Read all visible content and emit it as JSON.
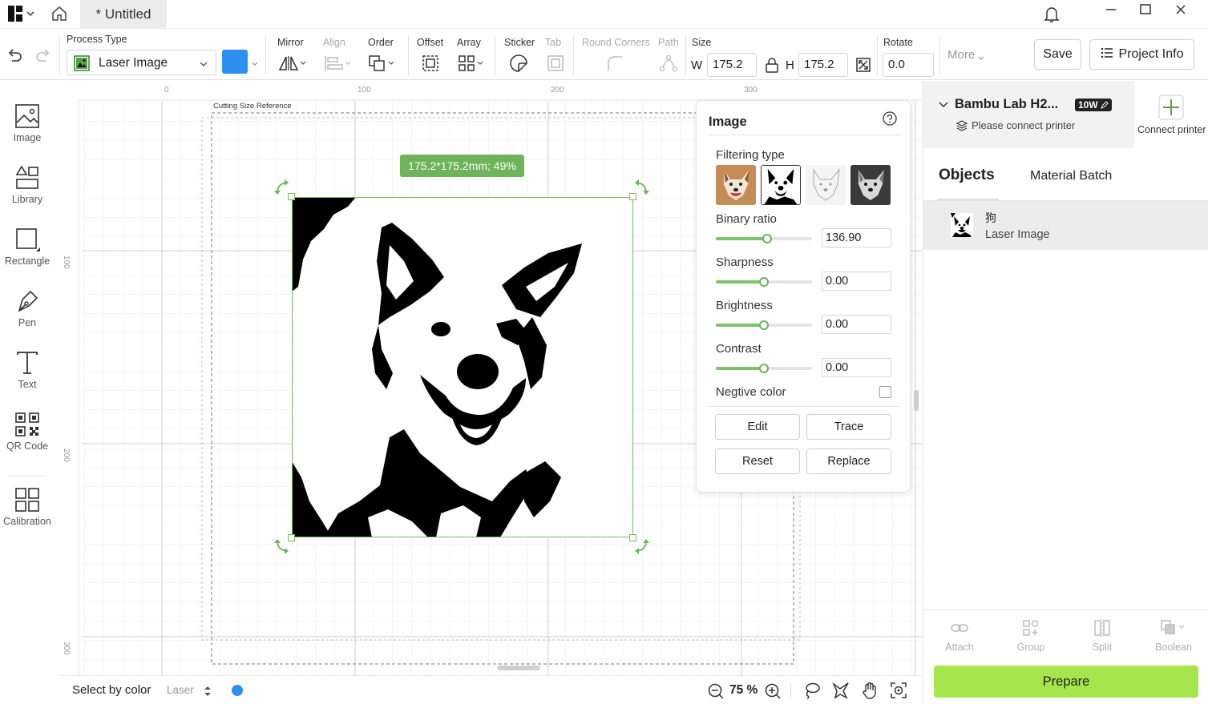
{
  "app": {
    "tab_title": "* Untitled"
  },
  "toolbar": {
    "process_type_label": "Process Type",
    "process_type_value": "Laser Image",
    "color_hex": "#2d8ff0",
    "mirror_label": "Mirror",
    "align_label": "Align",
    "order_label": "Order",
    "offset_label": "Offset",
    "array_label": "Array",
    "sticker_label": "Sticker",
    "tab_label": "Tab",
    "round_corners_label": "Round Corners",
    "path_label": "Path",
    "size_label": "Size",
    "w_label": "W",
    "w_value": "175.2",
    "h_label": "H",
    "h_value": "175.2",
    "rotate_label": "Rotate",
    "rotate_value": "0.0",
    "more_label": "More",
    "save_label": "Save",
    "project_info_label": "Project Info"
  },
  "left_tools": [
    {
      "label": "Image",
      "icon": "image-icon"
    },
    {
      "label": "Library",
      "icon": "library-icon"
    },
    {
      "label": "Rectangle",
      "icon": "rectangle-icon"
    },
    {
      "label": "Pen",
      "icon": "pen-icon"
    },
    {
      "label": "Text",
      "icon": "text-icon"
    },
    {
      "label": "QR Code",
      "icon": "qr-code-icon"
    },
    {
      "label": "Calibration",
      "icon": "calibration-icon"
    }
  ],
  "canvas": {
    "ruler_top": [
      "0",
      "100",
      "200",
      "300"
    ],
    "ruler_left": [
      "100",
      "200",
      "300"
    ],
    "cutting_size_reference": "Cutting Size Reference",
    "size_tooltip": "175.2*175.2mm; 49%"
  },
  "image_panel": {
    "title": "Image",
    "filtering_type_label": "Filtering type",
    "binary_ratio_label": "Binary ratio",
    "binary_ratio_value": "136.90",
    "binary_ratio_level": 0.53,
    "sharpness_label": "Sharpness",
    "sharpness_value": "0.00",
    "sharpness_level": 0.5,
    "brightness_label": "Brightness",
    "brightness_value": "0.00",
    "brightness_level": 0.5,
    "contrast_label": "Contrast",
    "contrast_value": "0.00",
    "contrast_level": 0.5,
    "negative_color_label": "Negtive color",
    "negative_color_checked": false,
    "edit_label": "Edit",
    "trace_label": "Trace",
    "reset_label": "Reset",
    "replace_label": "Replace"
  },
  "printer": {
    "name": "Bambu Lab H2...",
    "power_badge": "10W",
    "status": "Please connect printer",
    "connect_label": "Connect printer"
  },
  "right_tabs": {
    "objects_label": "Objects",
    "material_batch_label": "Material Batch"
  },
  "objects": [
    {
      "name": "狗",
      "type": "Laser Image"
    }
  ],
  "right_tools": [
    {
      "label": "Attach",
      "icon": "link-icon"
    },
    {
      "label": "Group",
      "icon": "group-icon"
    },
    {
      "label": "Split",
      "icon": "split-icon"
    },
    {
      "label": "Boolean",
      "icon": "boolean-icon"
    }
  ],
  "prepare_label": "Prepare",
  "status_bar": {
    "select_by_color_label": "Select by color",
    "laser_label": "Laser",
    "laser_color_hex": "#2d8ff0",
    "zoom_value": "75 %"
  },
  "colors": {
    "accent_green": "#a6e64c",
    "selection_green": "#7cb85f",
    "tooltip_green": "#6fb35a"
  }
}
